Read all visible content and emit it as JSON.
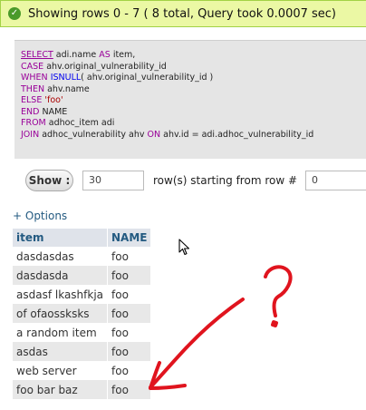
{
  "message": {
    "icon": "check-icon",
    "text": "Showing rows 0 - 7 ( 8 total, Query took 0.0007 sec)"
  },
  "sql": {
    "lines": [
      [
        {
          "t": "SELECT",
          "c": "select-kw"
        },
        {
          "t": " adi.name ",
          "c": "plain"
        },
        {
          "t": "AS",
          "c": "kw"
        },
        {
          "t": " item,",
          "c": "plain"
        }
      ],
      [
        {
          "t": "CASE",
          "c": "kw"
        },
        {
          "t": " ahv.original_vulnerability_id",
          "c": "plain"
        }
      ],
      [
        {
          "t": "WHEN",
          "c": "kw"
        },
        {
          "t": " ",
          "c": "plain"
        },
        {
          "t": "ISNULL",
          "c": "fn-name"
        },
        {
          "t": "( ahv.original_vulnerability_id )",
          "c": "plain"
        }
      ],
      [
        {
          "t": "THEN",
          "c": "kw"
        },
        {
          "t": " ahv.name",
          "c": "plain"
        }
      ],
      [
        {
          "t": "ELSE",
          "c": "kw"
        },
        {
          "t": " ",
          "c": "plain"
        },
        {
          "t": "'foo'",
          "c": "fn"
        }
      ],
      [
        {
          "t": "END",
          "c": "kw"
        },
        {
          "t": " NAME",
          "c": "plain"
        }
      ],
      [
        {
          "t": "FROM",
          "c": "kw"
        },
        {
          "t": " adhoc_item adi",
          "c": "plain"
        }
      ],
      [
        {
          "t": "JOIN",
          "c": "kw"
        },
        {
          "t": " adhoc_vulnerability ahv ",
          "c": "plain"
        },
        {
          "t": "ON",
          "c": "kw"
        },
        {
          "t": " ahv.id = adi.adhoc_vulnerability_id",
          "c": "plain"
        }
      ]
    ]
  },
  "controls": {
    "show_label": "Show :",
    "rows_value": "30",
    "starting_label": "row(s) starting from row #",
    "start_value": "0"
  },
  "options_link": "+ Options",
  "table": {
    "columns": [
      "item",
      "NAME"
    ],
    "rows": [
      [
        "dasdasdas",
        "foo"
      ],
      [
        "dasdasda",
        "foo"
      ],
      [
        "asdasf lkashfkja",
        "foo"
      ],
      [
        "of ofaossksks",
        "foo"
      ],
      [
        "a random item",
        "foo"
      ],
      [
        "asdas",
        "foo"
      ],
      [
        "web server",
        "foo"
      ],
      [
        "foo bar baz",
        "foo"
      ]
    ]
  },
  "annotation": {
    "color": "#e0141e",
    "question_mark": "?"
  }
}
